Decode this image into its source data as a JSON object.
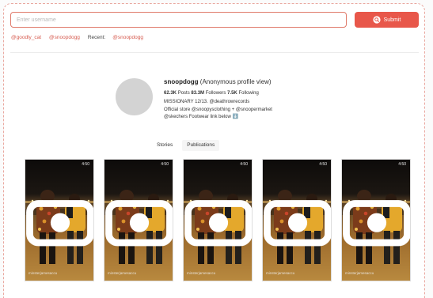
{
  "search": {
    "placeholder": "Enter username",
    "submit_label": "Submit"
  },
  "quick_links": {
    "first": "@goodly_cat",
    "second": "@snoopdogg",
    "recent_label": "Recent:",
    "recent": "@snoopdogg"
  },
  "profile": {
    "username": "snoopdogg",
    "view_label": "(Anonymous profile view)",
    "posts_count": "62.3K",
    "posts_label": "Posts",
    "followers_count": "83.3M",
    "followers_label": "Followers",
    "following_count": "7.5K",
    "following_label": "Following",
    "bio": [
      "MISSIONARY 12/13. @deathrowrecords",
      "Official store @snoopysclothing + @snoopermarket",
      "@skechers Footwear link below ⬇️"
    ]
  },
  "tabs": {
    "stories": "Stories",
    "publications": "Publications",
    "active": "Publications"
  },
  "stories": [
    {
      "time": "4:50",
      "watermark": "minsterjamesaccu"
    },
    {
      "time": "4:50",
      "watermark": "minsterjamesaccu"
    },
    {
      "time": "4:50",
      "watermark": "minsterjamesaccu"
    },
    {
      "time": "4:50",
      "watermark": "minsterjamesaccu"
    },
    {
      "time": "4:50",
      "watermark": "minsterjamesaccu"
    }
  ],
  "colors": {
    "accent": "#e8574a",
    "link": "#d65a4e",
    "avatar_placeholder": "#d3d3d3"
  }
}
